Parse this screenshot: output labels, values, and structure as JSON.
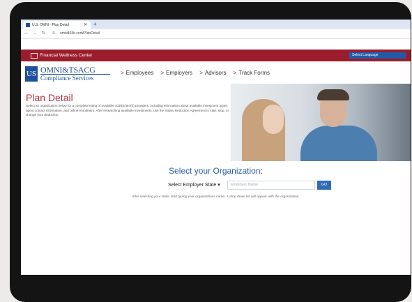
{
  "browser": {
    "tab_title": "U.S. OMNI - Plan Detail",
    "url": "omni403b.com/PlanDetail"
  },
  "header": {
    "banner_label": "Financial Wellness Center",
    "language_label": "Select Language"
  },
  "logo": {
    "line1": "OMNI&TSACG",
    "line2": "Compliance Services"
  },
  "nav": {
    "items": [
      "Employees",
      "Employers",
      "Advisors",
      "Track Forms"
    ]
  },
  "main": {
    "title": "Plan Detail",
    "description": "Select an organization below for a complete listing of available 403(b)/457(b) providers, including information about available investment types, agent contact information, and online enrollment. After researching available investments, use the Salary Reduction Agreement to start, stop, or change your deduction.",
    "select_heading": "Select your Organization:",
    "state_dropdown": "Select Employer State",
    "employer_placeholder": "Employer Name",
    "go_label": "GO",
    "hint": "After selecting your state, start typing your organizations name. A drop-down list will appear with the organization."
  },
  "colors": {
    "brand_red": "#9b1d2d",
    "brand_blue": "#1f4f9c",
    "heading_blue": "#2a5da8"
  }
}
